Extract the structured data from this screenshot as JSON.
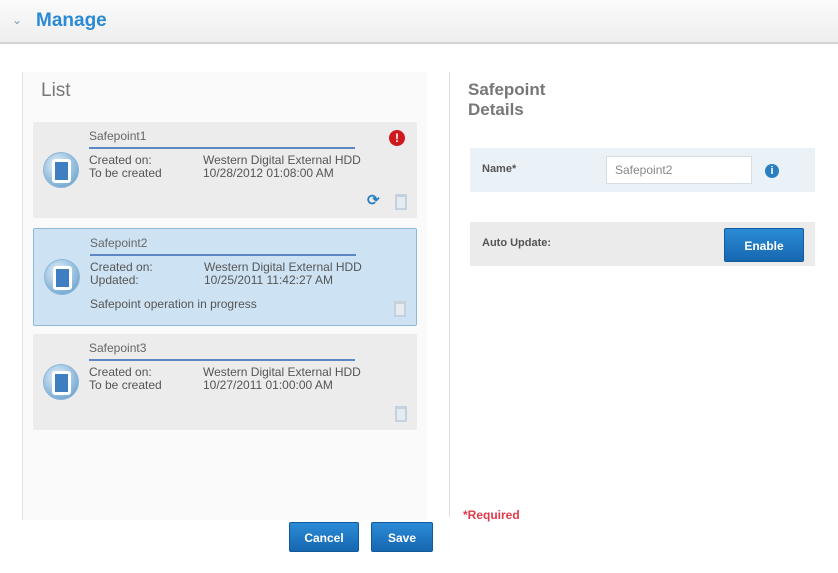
{
  "header": {
    "chevron": "⌄",
    "title": "Manage"
  },
  "list": {
    "title": "List",
    "items": [
      {
        "name": "Safepoint1",
        "row1_label": "Created on:",
        "row1_value": "Western Digital External HDD",
        "row2_label": "To be created",
        "row2_value": "10/28/2012 01:08:00 AM",
        "status": "",
        "alert": "!"
      },
      {
        "name": "Safepoint2",
        "row1_label": "Created on:",
        "row1_value": "Western Digital External HDD",
        "row2_label": "Updated:",
        "row2_value": "10/25/2011 11:42:27 AM",
        "status": "Safepoint operation in progress"
      },
      {
        "name": "Safepoint3",
        "row1_label": "Created on:",
        "row1_value": "Western Digital External HDD",
        "row2_label": "To be created",
        "row2_value": "10/27/2011 01:00:00 AM",
        "status": ""
      }
    ]
  },
  "buttons": {
    "cancel": "Cancel",
    "save": "Save",
    "enable": "Enable"
  },
  "details": {
    "title": "Safepoint Details",
    "name_label": "Name*",
    "name_value": "Safepoint2",
    "info": "i",
    "auto_update_label": "Auto Update:",
    "required_note": "*Required"
  },
  "icons": {
    "collapse": "chevron-down-icon",
    "safepoint": "safepoint-disk-icon",
    "alert": "alert-icon",
    "sync": "sync-icon",
    "trash": "trash-icon",
    "info": "info-icon"
  },
  "colors": {
    "accent": "#2a8ad4",
    "button": "#1c74c2",
    "alert": "#d0191f",
    "required": "#e0394a"
  }
}
